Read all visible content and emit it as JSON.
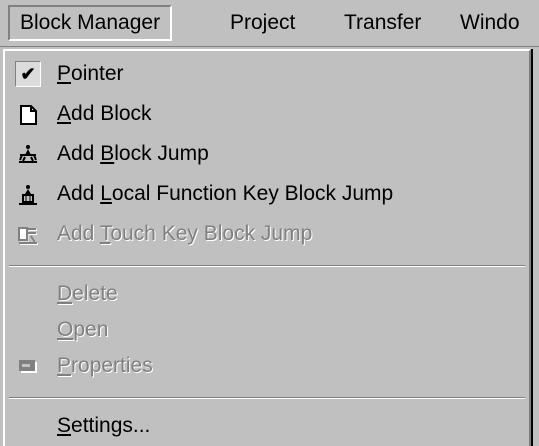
{
  "menubar": {
    "items": [
      {
        "label": "Block Manager"
      },
      {
        "label": "Project"
      },
      {
        "label": "Transfer"
      },
      {
        "label": "Windo"
      }
    ]
  },
  "menu": {
    "pointer": {
      "first": "P",
      "rest": "ointer",
      "checked": true,
      "check_glyph": "✔"
    },
    "add_block": {
      "first": "A",
      "rest": "dd Block",
      "icon": "blank-page-icon"
    },
    "add_block_jump": {
      "pre": "Add ",
      "first": "B",
      "rest": "lock Jump",
      "icon": "block-jump-icon"
    },
    "add_local_fk_jump": {
      "pre": "Add ",
      "first": "L",
      "rest": "ocal Function Key Block Jump",
      "icon": "function-key-jump-icon"
    },
    "add_touch_key_jump": {
      "pre": "Add ",
      "first": "T",
      "rest": "ouch Key Block Jump",
      "icon": "touch-key-jump-icon",
      "disabled": true
    },
    "delete": {
      "first": "D",
      "rest": "elete",
      "disabled": true
    },
    "open": {
      "first": "O",
      "rest": "pen",
      "disabled": true
    },
    "properties": {
      "first": "P",
      "rest": "roperties",
      "icon": "properties-icon",
      "disabled": true
    },
    "settings": {
      "first": "S",
      "rest": "ettings..."
    }
  }
}
